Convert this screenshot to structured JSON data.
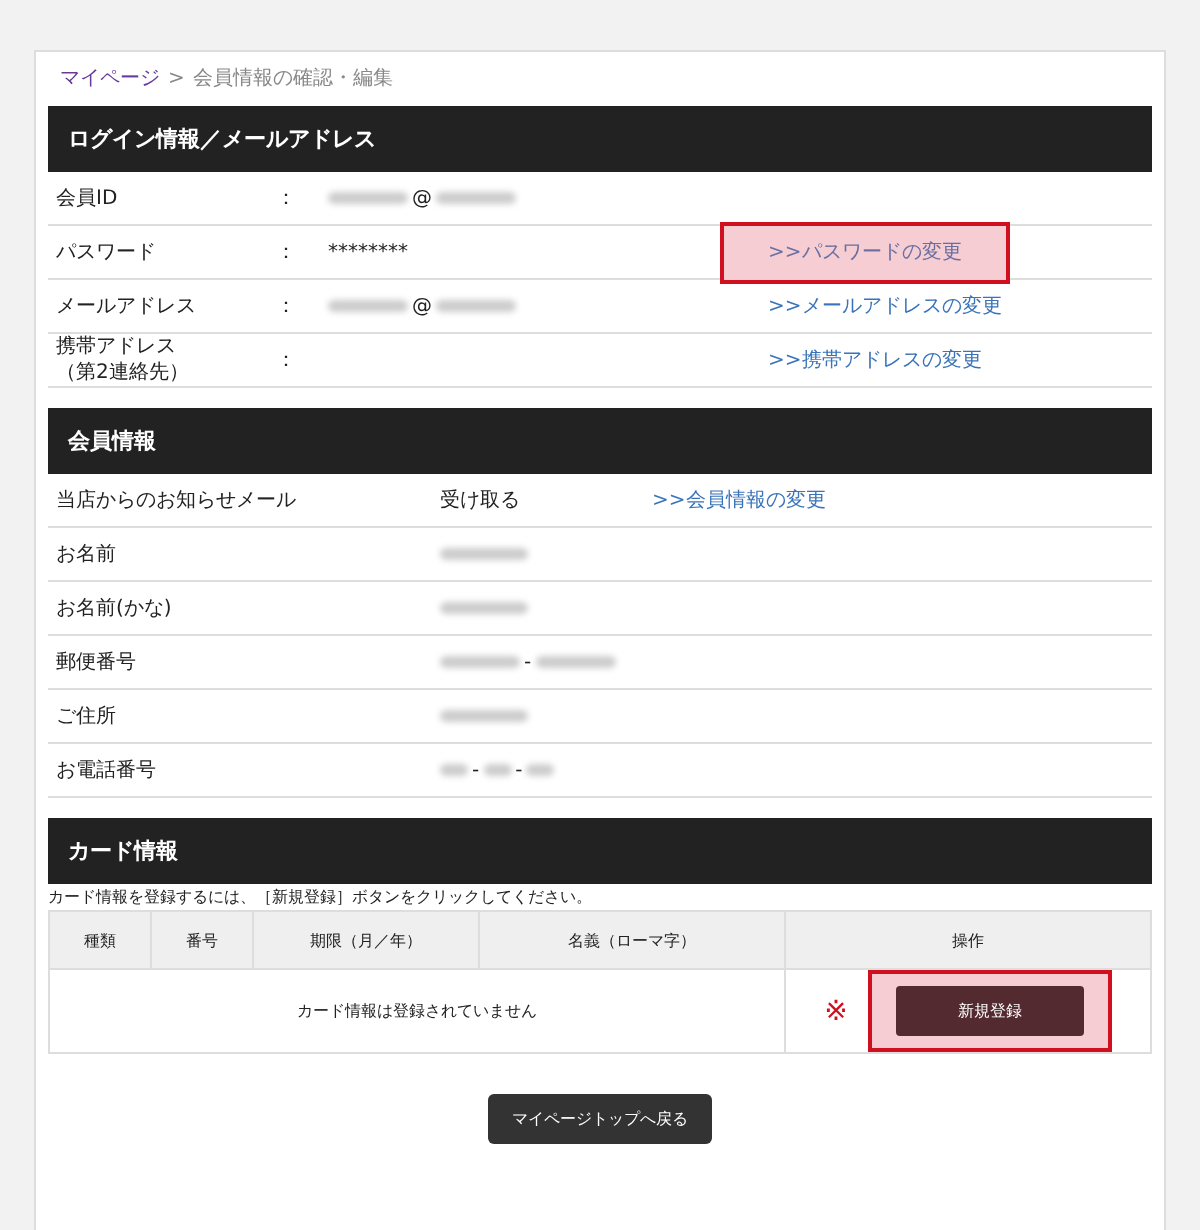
{
  "breadcrumb": [
    {
      "label": "マイページ",
      "link": true
    },
    {
      "label": "会員情報の確認・編集",
      "link": false
    }
  ],
  "breadcrumb_separator": ">",
  "login_section": {
    "title": "ログイン情報／メールアドレス",
    "colon": "：",
    "rows": [
      {
        "label": [
          "会員ID"
        ],
        "value": [
          {
            "kind": "blurred"
          },
          {
            "kind": "text",
            "text": "@"
          },
          {
            "kind": "blurred"
          }
        ]
      },
      {
        "label": [
          "パスワード"
        ],
        "value": [
          {
            "kind": "text",
            "text": "********"
          }
        ],
        "link": ">>パスワードの変更",
        "highlighted": true
      },
      {
        "label": [
          "メールアドレス"
        ],
        "value": [
          {
            "kind": "blurred"
          },
          {
            "kind": "text",
            "text": "@"
          },
          {
            "kind": "blurred"
          }
        ],
        "link": ">>メールアドレスの変更",
        "highlighted": false
      },
      {
        "label": [
          "携帯アドレス",
          "（第2連絡先）"
        ],
        "value": [],
        "link": ">>携帯アドレスの変更",
        "highlighted": false
      }
    ]
  },
  "member_section": {
    "title": "会員情報",
    "rows": [
      {
        "label": "当店からのお知らせメール",
        "value": [
          {
            "kind": "text",
            "text": "受け取る"
          }
        ],
        "link": ">>会員情報の変更"
      },
      {
        "label": "お名前",
        "value": [
          {
            "kind": "blurred"
          }
        ]
      },
      {
        "label": "お名前(かな)",
        "value": [
          {
            "kind": "blurred"
          }
        ]
      },
      {
        "label": "郵便番号",
        "value": [
          {
            "kind": "blurred"
          },
          {
            "kind": "text",
            "text": "-"
          },
          {
            "kind": "blurred"
          }
        ]
      },
      {
        "label": "ご住所",
        "value": [
          {
            "kind": "blurred"
          }
        ]
      },
      {
        "label": "お電話番号",
        "value": [
          {
            "kind": "blurred"
          },
          {
            "kind": "text",
            "text": "-"
          },
          {
            "kind": "blurred"
          },
          {
            "kind": "text",
            "text": "-"
          },
          {
            "kind": "blurred"
          }
        ]
      }
    ]
  },
  "card_section": {
    "title": "カード情報",
    "note": "カード情報を登録するには、［新規登録］ボタンをクリックしてください。",
    "columns": [
      "種類",
      "番号",
      "期限（月／年）",
      "名義（ローマ字）",
      "操作"
    ],
    "empty_message": "カード情報は登録されていません",
    "mark": "※",
    "register_button": "新規登録",
    "register_highlighted": true
  },
  "back_button": "マイページトップへ戻る"
}
